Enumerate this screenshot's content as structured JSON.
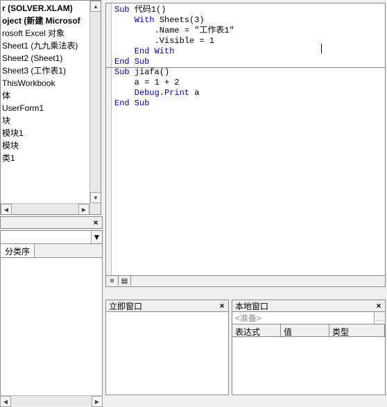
{
  "project_tree": {
    "lines": [
      {
        "text": "r (SOLVER.XLAM)",
        "bold": true
      },
      {
        "text": "oject (新建 Microsof",
        "bold": true
      },
      {
        "text": "rosoft Excel 对象",
        "bold": false
      },
      {
        "text": "Sheet1 (九九乘法表)",
        "bold": false
      },
      {
        "text": "Sheet2 (Sheet1)",
        "bold": false
      },
      {
        "text": "Sheet3 (工作表1)",
        "bold": false
      },
      {
        "text": "ThisWorkbook",
        "bold": false
      },
      {
        "text": "体",
        "bold": false
      },
      {
        "text": "UserForm1",
        "bold": false
      },
      {
        "text": "块",
        "bold": false
      },
      {
        "text": "模块1",
        "bold": false
      },
      {
        "text": "模块",
        "bold": false
      },
      {
        "text": "类1",
        "bold": false
      }
    ]
  },
  "prop_tabs": {
    "sort": "分类序"
  },
  "code": {
    "l1a": "Sub ",
    "l1b": "代码1()",
    "l2a": "    With ",
    "l2b": "Sheets(3)",
    "l3": "        .Name = \"工作表1\"",
    "l4": "        .Visible = 1",
    "l5": "    End With",
    "l6": "End Sub",
    "l7a": "Sub ",
    "l7b": "jiafa()",
    "l8": "    a = 1 + 2",
    "l9a": "    Debug",
    "l9b": ".",
    "l9c": "Print ",
    "l9d": "a",
    "l10": "End Sub"
  },
  "immediate": {
    "title": "立即窗口"
  },
  "locals": {
    "title": "本地窗口",
    "ready": "<准备>",
    "headers": {
      "expr": "表达式",
      "val": "值",
      "type": "类型"
    }
  }
}
